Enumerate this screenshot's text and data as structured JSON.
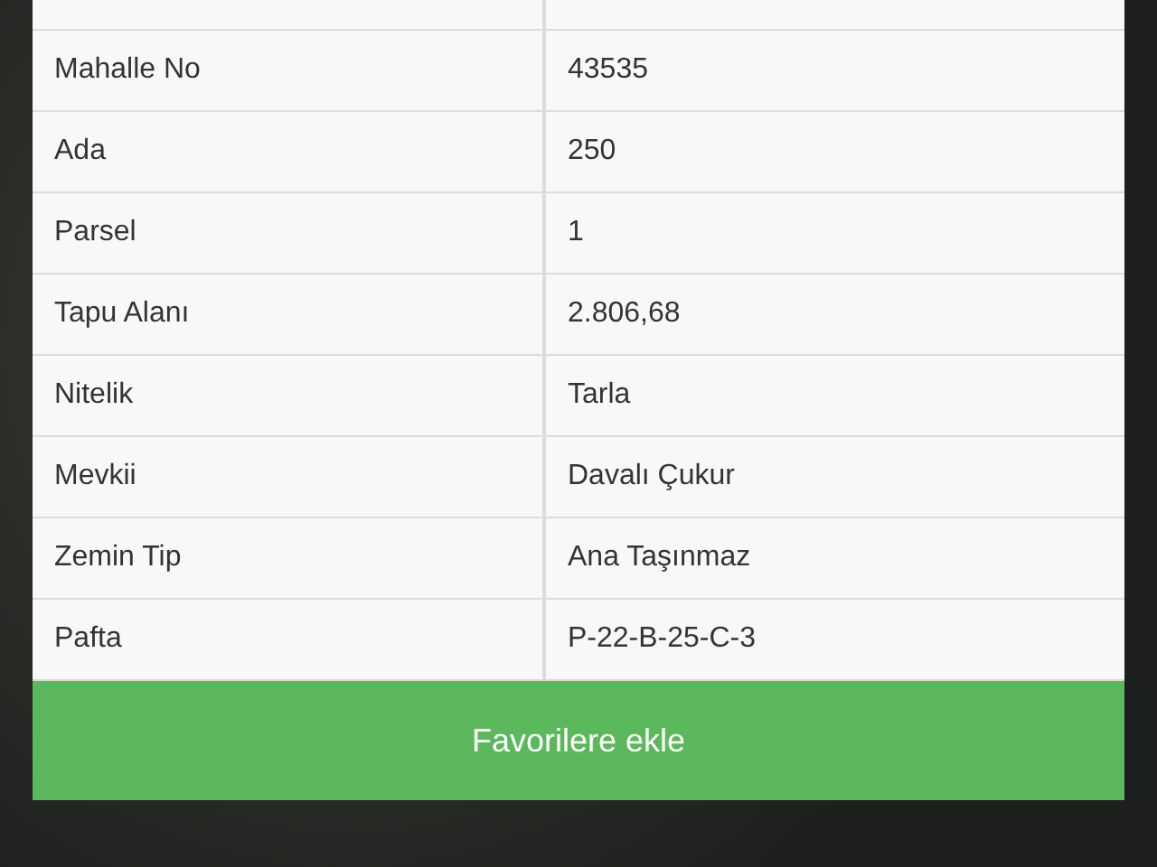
{
  "table": {
    "rows": [
      {
        "label": "Mahalle No",
        "value": "43535"
      },
      {
        "label": "Ada",
        "value": "250"
      },
      {
        "label": "Parsel",
        "value": "1"
      },
      {
        "label": "Tapu Alanı",
        "value": "2.806,68"
      },
      {
        "label": "Nitelik",
        "value": "Tarla"
      },
      {
        "label": "Mevkii",
        "value": "Davalı Çukur"
      },
      {
        "label": "Zemin Tip",
        "value": "Ana Taşınmaz"
      },
      {
        "label": "Pafta",
        "value": "P-22-B-25-C-3"
      }
    ]
  },
  "button": {
    "label": "Favorilere ekle"
  }
}
